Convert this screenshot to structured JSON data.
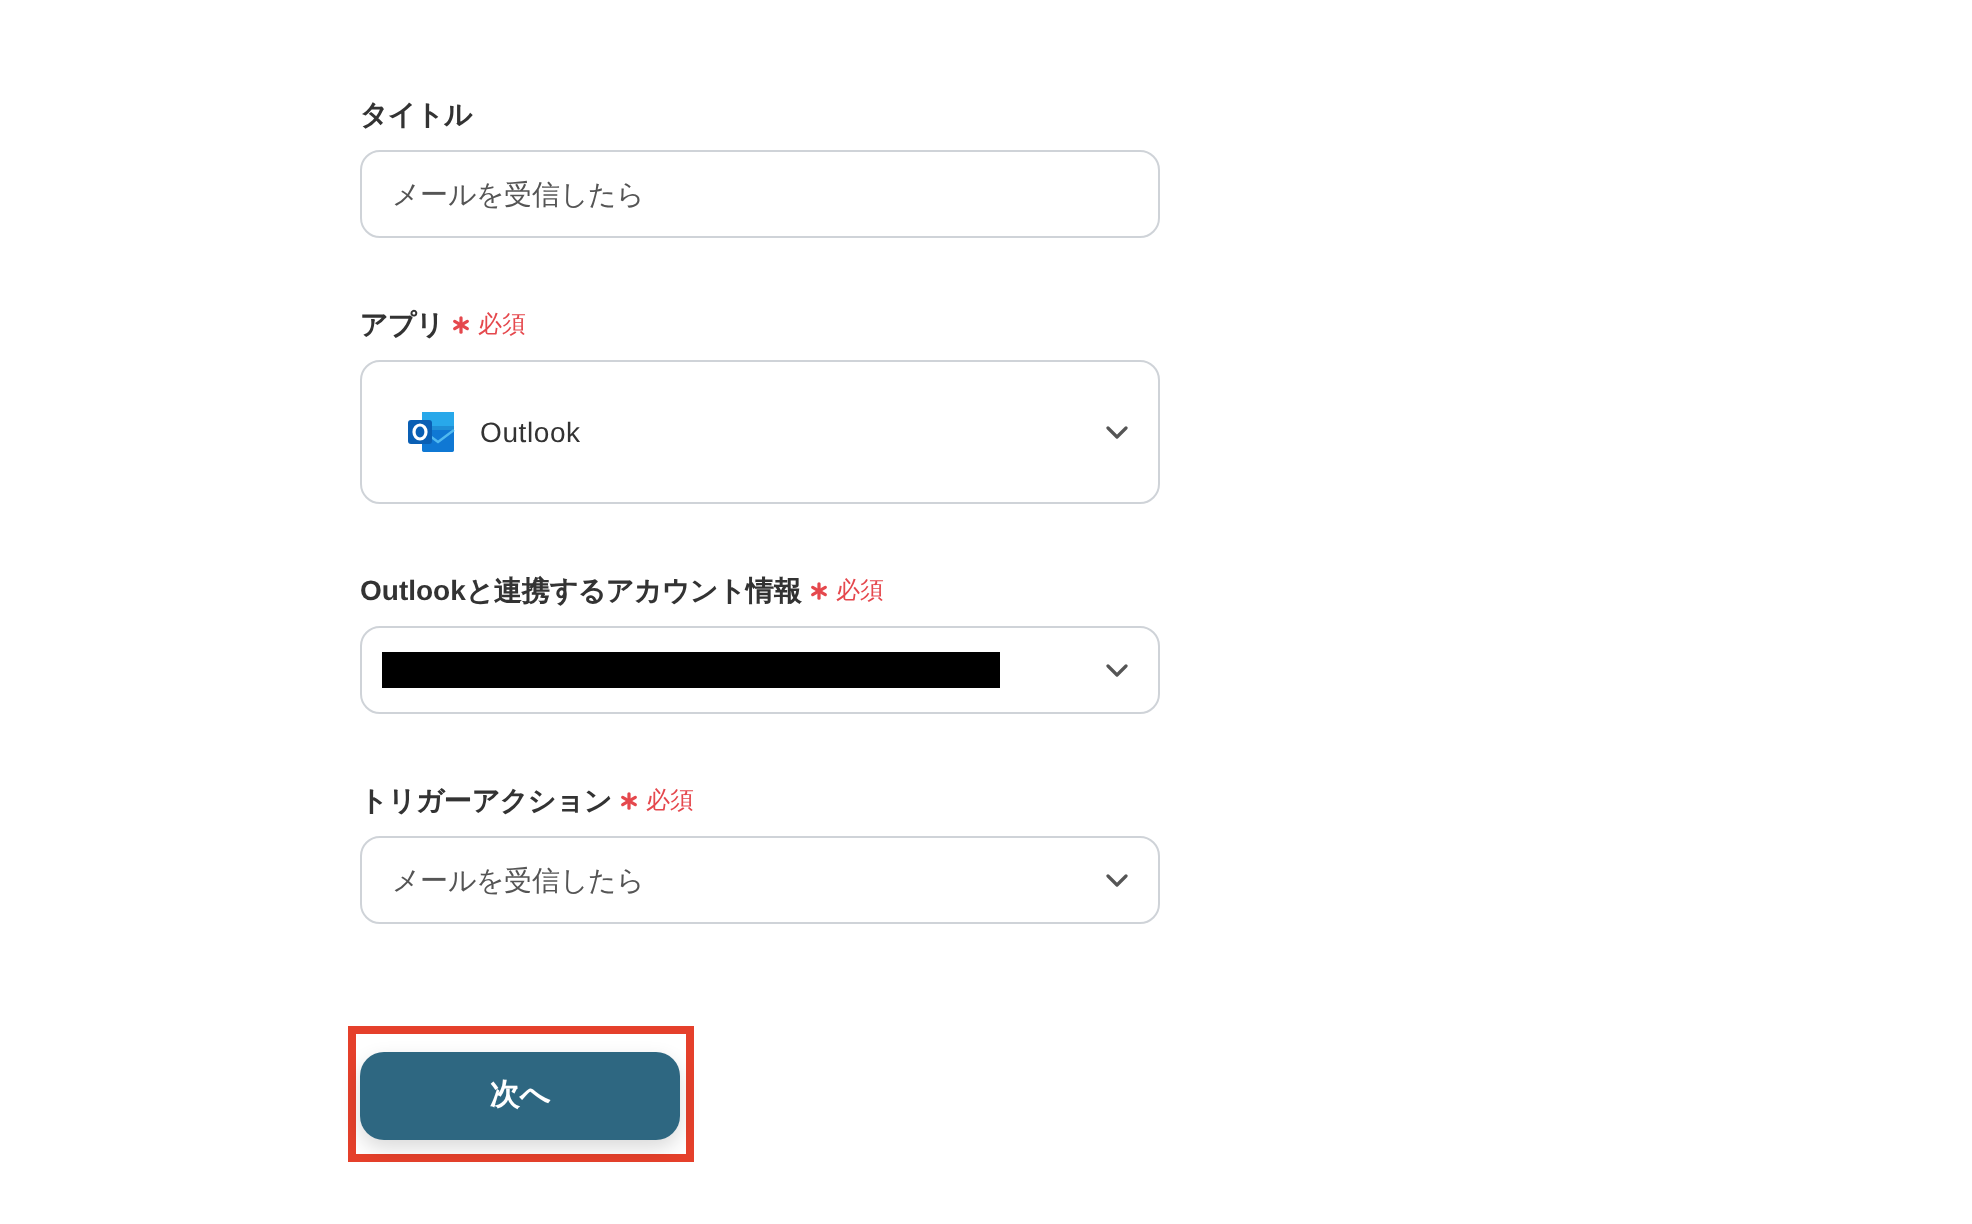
{
  "fields": [
    {
      "kind": "text",
      "label": "タイトル",
      "required": false,
      "value": "メールを受信したら"
    },
    {
      "kind": "app",
      "label": "アプリ",
      "required": true,
      "badge": "必須",
      "value": "Outlook"
    },
    {
      "kind": "select",
      "label": "Outlookと連携するアカウント情報",
      "required": true,
      "badge": "必須",
      "redacted": true
    },
    {
      "kind": "select",
      "label": "トリガーアクション",
      "required": true,
      "badge": "必須",
      "value": "メールを受信したら"
    }
  ],
  "button": {
    "label": "次へ",
    "highlighted": true
  }
}
